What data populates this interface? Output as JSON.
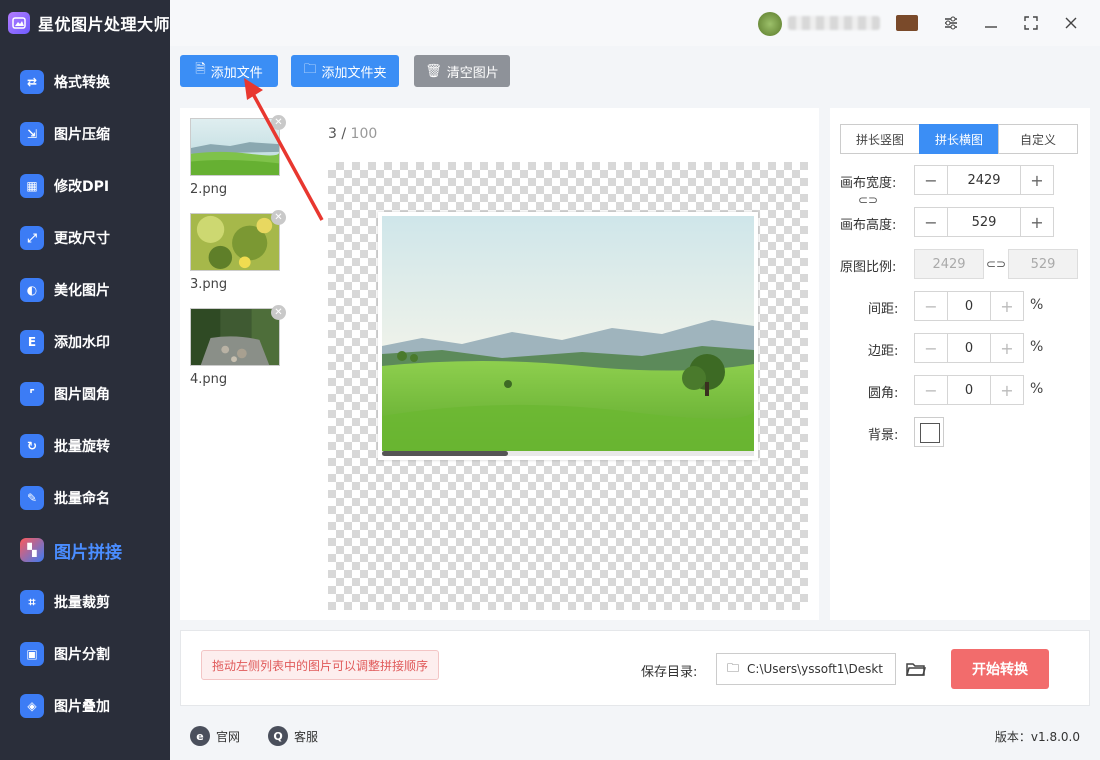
{
  "app": {
    "title": "星优图片处理大师"
  },
  "sidebar": {
    "items": [
      {
        "label": "格式转换",
        "icon": "image-convert-icon"
      },
      {
        "label": "图片压缩",
        "icon": "image-compress-icon"
      },
      {
        "label": "修改DPI",
        "icon": "dpi-icon"
      },
      {
        "label": "更改尺寸",
        "icon": "resize-icon"
      },
      {
        "label": "美化图片",
        "icon": "beautify-icon"
      },
      {
        "label": "添加水印",
        "icon": "watermark-icon"
      },
      {
        "label": "图片圆角",
        "icon": "rounded-corner-icon"
      },
      {
        "label": "批量旋转",
        "icon": "rotate-icon"
      },
      {
        "label": "批量命名",
        "icon": "rename-icon"
      },
      {
        "label": "图片拼接",
        "icon": "stitch-icon",
        "active": true
      },
      {
        "label": "批量裁剪",
        "icon": "crop-icon"
      },
      {
        "label": "图片分割",
        "icon": "split-icon"
      },
      {
        "label": "图片叠加",
        "icon": "overlay-icon"
      }
    ]
  },
  "toolbar": {
    "add_file": "添加文件",
    "add_folder": "添加文件夹",
    "clear": "清空图片"
  },
  "files": [
    {
      "name": "2.png"
    },
    {
      "name": "3.png"
    },
    {
      "name": "4.png"
    }
  ],
  "counter": {
    "current": "3",
    "separator": " / ",
    "total": "100"
  },
  "settings": {
    "tabs": [
      {
        "label": "拼长竖图"
      },
      {
        "label": "拼长横图",
        "active": true
      },
      {
        "label": "自定义"
      }
    ],
    "canvas_width_label": "画布宽度:",
    "canvas_width": "2429",
    "canvas_height_label": "画布高度:",
    "canvas_height": "529",
    "ratio_label": "原图比例:",
    "ratio_width": "2429",
    "ratio_height": "529",
    "spacing_label": "间距:",
    "spacing": "0",
    "margin_label": "边距:",
    "margin": "0",
    "radius_label": "圆角:",
    "radius": "0",
    "background_label": "背景:",
    "percent": "%",
    "minus": "−",
    "plus": "+"
  },
  "bottom": {
    "hint": "拖动左侧列表中的图片可以调整拼接顺序",
    "save_label": "保存目录:",
    "save_path": "C:\\Users\\yssoft1\\Deskt",
    "start": "开始转换"
  },
  "footer": {
    "website": "官网",
    "service": "客服",
    "version": "版本：v1.8.0.0"
  },
  "colors": {
    "accent": "#3b8ef5",
    "start_button": "#f26c6c",
    "sidebar_bg": "#2a2e3a",
    "annotation_arrow": "#e8372f"
  }
}
